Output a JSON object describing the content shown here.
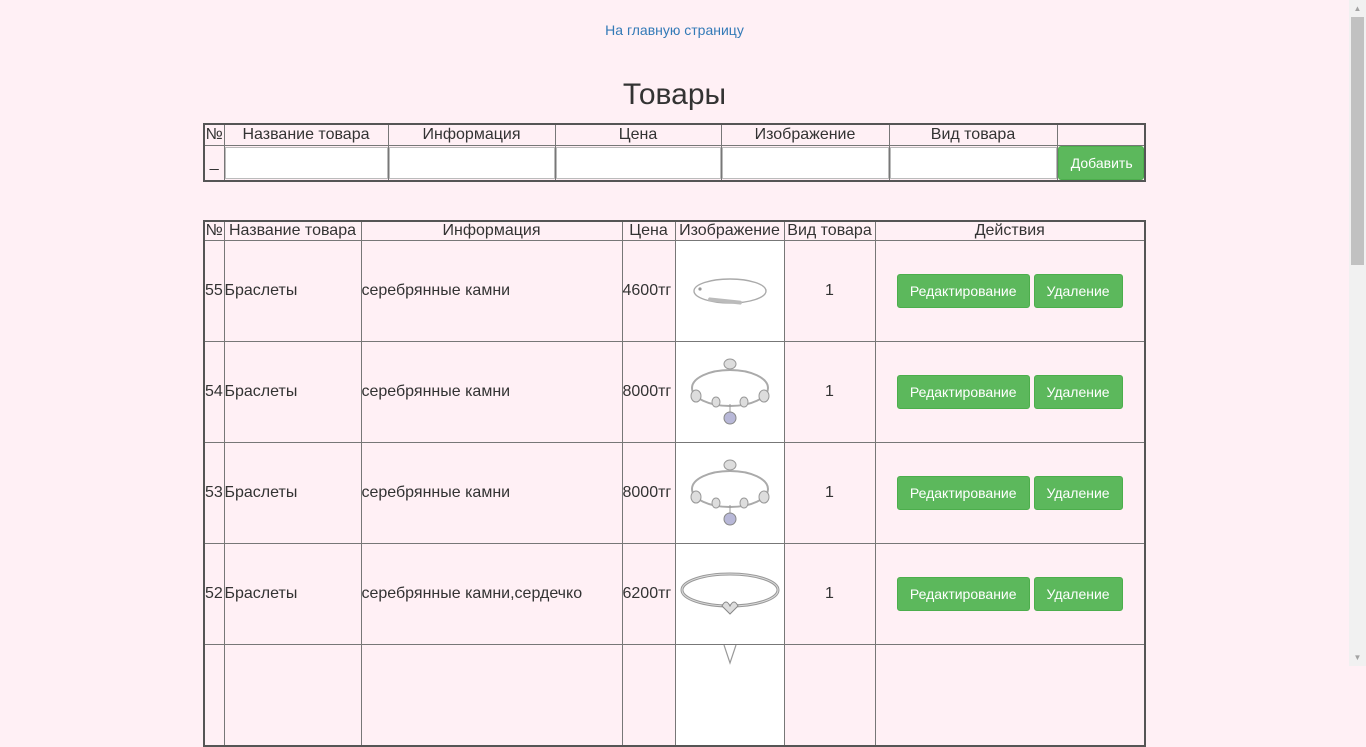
{
  "nav": {
    "home_link": "На главную страницу"
  },
  "title": "Товары",
  "add_form": {
    "headers": [
      "№",
      "Название товара",
      "Информация",
      "Цена",
      "Изображение",
      "Вид товара",
      ""
    ],
    "num_placeholder": "_",
    "inputs": {
      "name": "",
      "info": "",
      "price": "",
      "image": "",
      "type": ""
    },
    "add_button": "Добавить"
  },
  "list": {
    "headers": [
      "№",
      "Название товара",
      "Информация",
      "Цена",
      "Изображение",
      "Вид товара",
      "Действия"
    ],
    "rows": [
      {
        "id": "55",
        "name": "Браслеты",
        "info": "серебрянные камни",
        "price": "4600тг",
        "image": "thin-chain-bracelet",
        "type": "1"
      },
      {
        "id": "54",
        "name": "Браслеты",
        "info": "серебрянные камни",
        "price": "8000тг",
        "image": "charm-bracelet",
        "type": "1"
      },
      {
        "id": "53",
        "name": "Браслеты",
        "info": "серебрянные камни",
        "price": "8000тг",
        "image": "charm-bracelet",
        "type": "1"
      },
      {
        "id": "52",
        "name": "Браслеты",
        "info": "серебрянные камни,сердечко",
        "price": "6200тг",
        "image": "snake-chain-heart-bracelet",
        "type": "1"
      }
    ],
    "edit_label": "Редактирование",
    "delete_label": "Удаление"
  },
  "colors": {
    "background": "#fff0f5",
    "button": "#5cb85c",
    "link": "#337ab7"
  }
}
